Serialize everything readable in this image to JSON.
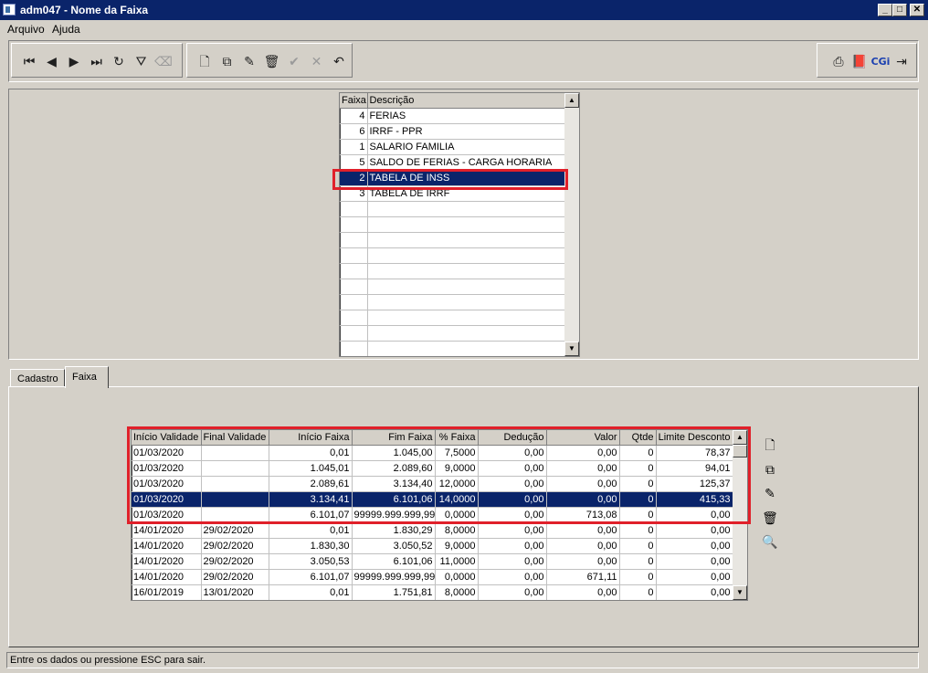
{
  "window": {
    "title": "adm047 - Nome da Faixa",
    "minimize": "_",
    "maximize": "□",
    "close": "✕"
  },
  "menu": [
    "Arquivo",
    "Ajuda"
  ],
  "toolbar": {
    "nav": [
      {
        "icon": "first-record-icon",
        "glyph": "⏮"
      },
      {
        "icon": "prev-record-icon",
        "glyph": "◀"
      },
      {
        "icon": "next-record-icon",
        "glyph": "▶"
      },
      {
        "icon": "last-record-icon",
        "glyph": "⏭"
      },
      {
        "icon": "refresh-icon",
        "glyph": "↻"
      },
      {
        "icon": "filter-icon",
        "glyph": "⛛"
      },
      {
        "icon": "clear-filter-icon",
        "glyph": "⌫"
      }
    ],
    "edit": [
      {
        "icon": "new-icon",
        "glyph": "🗋"
      },
      {
        "icon": "copy-icon",
        "glyph": "⧉"
      },
      {
        "icon": "edit-icon",
        "glyph": "✎"
      },
      {
        "icon": "delete-icon",
        "glyph": "🗑"
      },
      {
        "icon": "confirm-icon",
        "glyph": "✔"
      },
      {
        "icon": "cancel-icon",
        "glyph": "✕"
      },
      {
        "icon": "undo-icon",
        "glyph": "↶"
      }
    ],
    "right": [
      {
        "icon": "print-icon",
        "glyph": "⎙"
      },
      {
        "icon": "help-book-icon",
        "glyph": "📕"
      },
      {
        "icon": "cgi-logo-icon",
        "glyph": "CGi"
      },
      {
        "icon": "exit-icon",
        "glyph": "⇥"
      }
    ]
  },
  "faixa_list": {
    "columns": [
      "Faixa",
      "Descrição"
    ],
    "rows": [
      {
        "faixa": "4",
        "descricao": "FERIAS"
      },
      {
        "faixa": "6",
        "descricao": "IRRF - PPR"
      },
      {
        "faixa": "1",
        "descricao": "SALARIO FAMILIA"
      },
      {
        "faixa": "5",
        "descricao": "SALDO DE FERIAS - CARGA HORARIA"
      },
      {
        "faixa": "2",
        "descricao": "TABELA DE INSS"
      },
      {
        "faixa": "3",
        "descricao": "TABELA DE IRRF"
      }
    ],
    "selected_index": 4
  },
  "tabs": [
    "Cadastro",
    "Faixa"
  ],
  "active_tab": "Faixa",
  "faixa_grid": {
    "columns": [
      "Início Validade",
      "Final Validade",
      "Início Faixa",
      "Fim Faixa",
      "% Faixa",
      "Dedução",
      "Valor",
      "Qtde",
      "Limite Desconto"
    ],
    "rows": [
      [
        "01/03/2020",
        "",
        "0,01",
        "1.045,00",
        "7,5000",
        "0,00",
        "0,00",
        "0",
        "78,37"
      ],
      [
        "01/03/2020",
        "",
        "1.045,01",
        "2.089,60",
        "9,0000",
        "0,00",
        "0,00",
        "0",
        "94,01"
      ],
      [
        "01/03/2020",
        "",
        "2.089,61",
        "3.134,40",
        "12,0000",
        "0,00",
        "0,00",
        "0",
        "125,37"
      ],
      [
        "01/03/2020",
        "",
        "3.134,41",
        "6.101,06",
        "14,0000",
        "0,00",
        "0,00",
        "0",
        "415,33"
      ],
      [
        "01/03/2020",
        "",
        "6.101,07",
        "99999.999.999,99",
        "0,0000",
        "0,00",
        "713,08",
        "0",
        "0,00"
      ],
      [
        "14/01/2020",
        "29/02/2020",
        "0,01",
        "1.830,29",
        "8,0000",
        "0,00",
        "0,00",
        "0",
        "0,00"
      ],
      [
        "14/01/2020",
        "29/02/2020",
        "1.830,30",
        "3.050,52",
        "9,0000",
        "0,00",
        "0,00",
        "0",
        "0,00"
      ],
      [
        "14/01/2020",
        "29/02/2020",
        "3.050,53",
        "6.101,06",
        "11,0000",
        "0,00",
        "0,00",
        "0",
        "0,00"
      ],
      [
        "14/01/2020",
        "29/02/2020",
        "6.101,07",
        "99999.999.999,99",
        "0,0000",
        "0,00",
        "671,11",
        "0",
        "0,00"
      ],
      [
        "16/01/2019",
        "13/01/2020",
        "0,01",
        "1.751,81",
        "8,0000",
        "0,00",
        "0,00",
        "0",
        "0,00"
      ]
    ],
    "selected_index": 3
  },
  "side_buttons": [
    {
      "icon": "new-record-icon",
      "glyph": "🗋"
    },
    {
      "icon": "copy-record-icon",
      "glyph": "⧉"
    },
    {
      "icon": "edit-record-icon",
      "glyph": "✎"
    },
    {
      "icon": "delete-record-icon",
      "glyph": "🗑"
    },
    {
      "icon": "search-record-icon",
      "glyph": "🔍"
    }
  ],
  "status": "Entre os dados ou pressione ESC para sair.",
  "colors": {
    "selection": "#0a246a",
    "highlight": "#e0202a",
    "face": "#d4d0c8"
  }
}
